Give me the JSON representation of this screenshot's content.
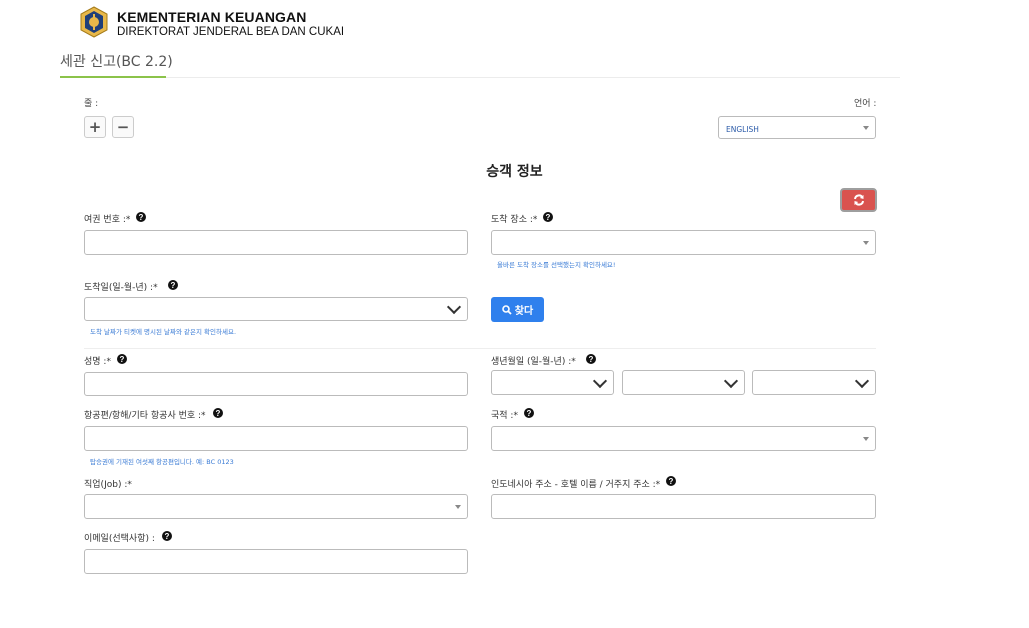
{
  "header": {
    "org_name": "KEMENTERIAN KEUANGAN",
    "org_sub": "DIREKTORAT JENDERAL BEA DAN CUKAI",
    "tab_title": "세관 신고(BC 2.2)"
  },
  "toolbar": {
    "row_label": "줄 :",
    "add_symbol": "+",
    "remove_symbol": "−",
    "language_label": "언어 :",
    "language_value": "ENGLISH"
  },
  "section": {
    "title": "승객 정보",
    "search_label": "찾다"
  },
  "fields": {
    "passport_label": "여권 번호 :*",
    "arrival_place_label": "도착 장소 :*",
    "arrival_place_hint": "올바른 도착 장소를 선택했는지 확인하세요!",
    "arrival_date_label": "도착일(일-월-년) :*",
    "arrival_date_hint": "도착 날짜가 티켓에 명시된 날짜와 같은지 확인하세요.",
    "name_label": "성명 :*",
    "dob_label": "생년월일 (일-월-년) :*",
    "flight_label": "항공편/항해/기타 항공사 번호 :*",
    "flight_hint": "탑승권에 기재된 여섯째 항공편입니다. 예: BC 0123",
    "nationality_label": "국적 :*",
    "job_label": "직업(Job) :*",
    "address_label": "인도네시아 주소 - 호텔 이름 / 거주지 주소 :*",
    "email_label": "이메일(선택사항) :"
  },
  "icons": {
    "help": "?",
    "refresh": "refresh-icon",
    "search": "search-icon",
    "logo": "kemenkeu-logo"
  },
  "colors": {
    "accent_green": "#8bc34a",
    "refresh_red": "#d9534f",
    "search_blue": "#2f80ed",
    "hint_blue": "#3a7bd5"
  }
}
